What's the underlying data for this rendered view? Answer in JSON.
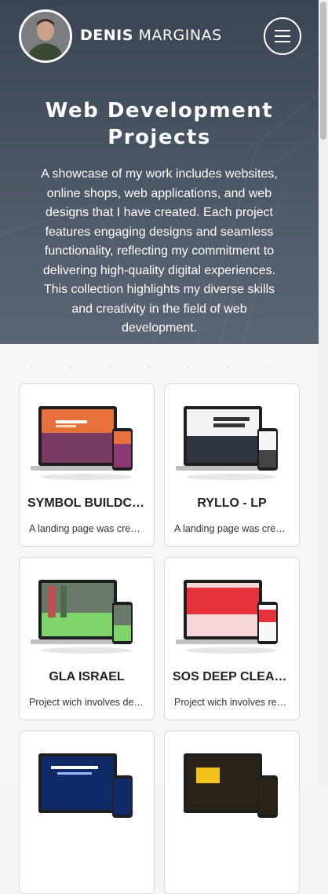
{
  "header": {
    "brand_first": "DENIS",
    "brand_last": "MARGINAS",
    "menu_icon": "hamburger-icon"
  },
  "hero": {
    "title_line1": "Web Development",
    "title_line2": "Projects",
    "description": "A showcase of my work includes websites, online shops, web applications, and web designs that I have created. Each project features engaging designs and seamless functionality, reflecting my commitment to delivering high-quality digital experiences. This collection highlights my diverse skills and creativity in the field of web development."
  },
  "projects": [
    {
      "title": "SYMBOL BUILDCON",
      "description": "A landing page was created for Symbol Buildcon"
    },
    {
      "title": "RYLLO - LP",
      "description": "A landing page was created for Ryllo"
    },
    {
      "title": "GLA ISRAEL",
      "description": "Project wich involves design and development"
    },
    {
      "title": "SOS DEEP CLEANING",
      "description": "Project wich involves remake of the website"
    },
    {
      "title": "",
      "description": ""
    },
    {
      "title": "",
      "description": ""
    }
  ],
  "colors": {
    "hero_bg": "#45505f",
    "accent": "#ffffff"
  }
}
